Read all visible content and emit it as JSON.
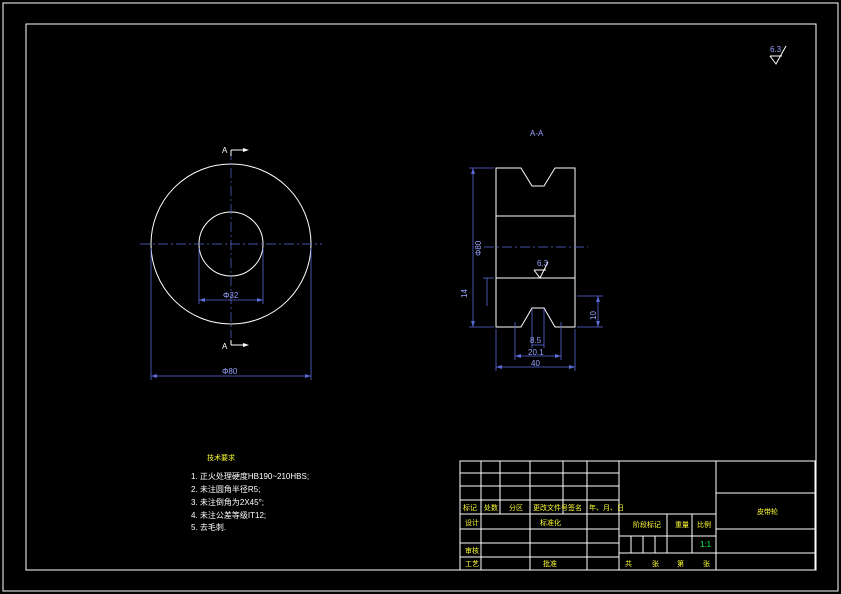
{
  "section_title": "A-A",
  "section_marker": "A",
  "roughness_value": "6.3",
  "dims": {
    "outer_dia_left": "Φ80",
    "bore_dia": "Φ32",
    "section_dia": "Φ80",
    "groove_top": "8.5",
    "groove_mid": "20.1",
    "width": "40",
    "height_left": "14",
    "height_right": "10"
  },
  "tech_req": {
    "title": "技术要求",
    "items": [
      "1. 正火处理硬度HB190~210HBS;",
      "2. 未注圆角半径R5;",
      "3. 未注倒角为2X45°;",
      "4. 未注公差等级IT12;",
      "5. 去毛刺."
    ]
  },
  "title_block": {
    "row_labels_a": [
      "标记",
      "处数",
      "分区",
      "更改文件号",
      "签名",
      "年、月、日"
    ],
    "design": "设计",
    "standardize": "标准化",
    "review": "审核",
    "process": "工艺",
    "approve": "批准",
    "stage_mark": "阶段标记",
    "weight": "重量",
    "scale": "比例",
    "scale_value": "1:1",
    "sheet_total": "共",
    "sheet_zhang": "张",
    "sheet_di": "第",
    "sheet_zhang2": "张",
    "part_name": "皮带轮"
  }
}
